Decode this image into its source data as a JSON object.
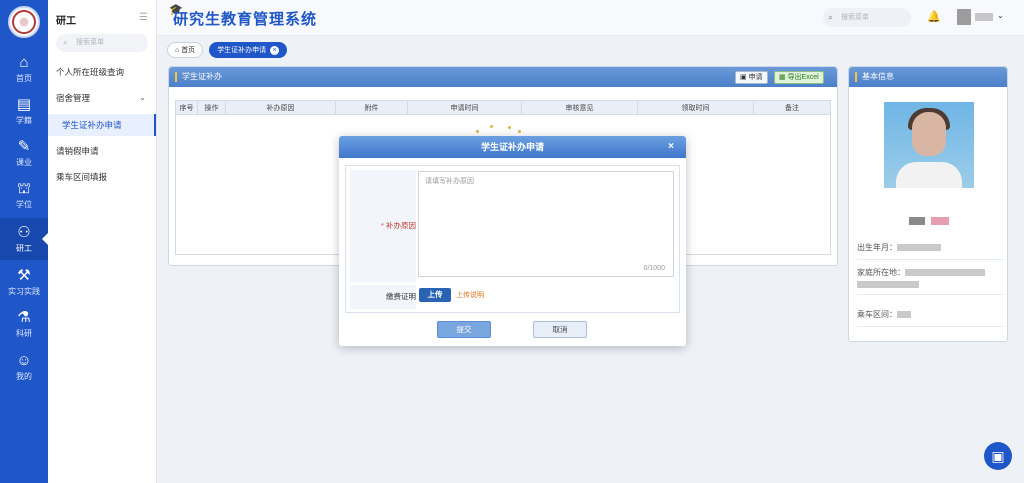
{
  "rail": {
    "items": [
      {
        "label": "首页",
        "icon": "home-icon"
      },
      {
        "label": "学籍",
        "icon": "id-card-icon"
      },
      {
        "label": "课业",
        "icon": "book-icon"
      },
      {
        "label": "学位",
        "icon": "graduation-cap-icon"
      },
      {
        "label": "研工",
        "icon": "people-icon"
      },
      {
        "label": "实习实践",
        "icon": "briefcase-icon"
      },
      {
        "label": "科研",
        "icon": "flask-icon"
      },
      {
        "label": "我的",
        "icon": "user-icon"
      }
    ]
  },
  "sidebar": {
    "title": "研工",
    "search_placeholder": "搜索菜单",
    "items": [
      {
        "label": "个人所在班级查询"
      },
      {
        "label": "宿舍管理"
      },
      {
        "label": "学生证补办申请"
      },
      {
        "label": "请销假申请"
      },
      {
        "label": "乘车区间填报"
      }
    ]
  },
  "header": {
    "title": "研究生教育管理系统",
    "search_placeholder": "搜索菜单"
  },
  "breadcrumbs": [
    {
      "label": "首页",
      "icon": "home-icon"
    },
    {
      "label": "学生证补办申请"
    }
  ],
  "panel": {
    "title": "学生证补办",
    "apply_label": "申请",
    "export_label": "导出Excel",
    "columns": [
      "序号",
      "操作",
      "补办原因",
      "附件",
      "申请时间",
      "审核意见",
      "领取时间",
      "备注"
    ]
  },
  "info": {
    "title": "基本信息",
    "birth_label": "出生年月：",
    "home_label": "家庭所在地：",
    "route_label": "乘车区间："
  },
  "modal": {
    "title": "学生证补办申请",
    "reason_label": "补办原因",
    "required_mark": "*",
    "reason_placeholder": "请填写补办原因",
    "counter": "0/1000",
    "fee_label": "缴费证明",
    "upload_label": "上传",
    "upload_help": "上传说明",
    "submit_label": "提交",
    "cancel_label": "取消"
  },
  "colors": {
    "primary": "#1f56c8",
    "required": "#e04b3b",
    "help": "#e0751d"
  }
}
